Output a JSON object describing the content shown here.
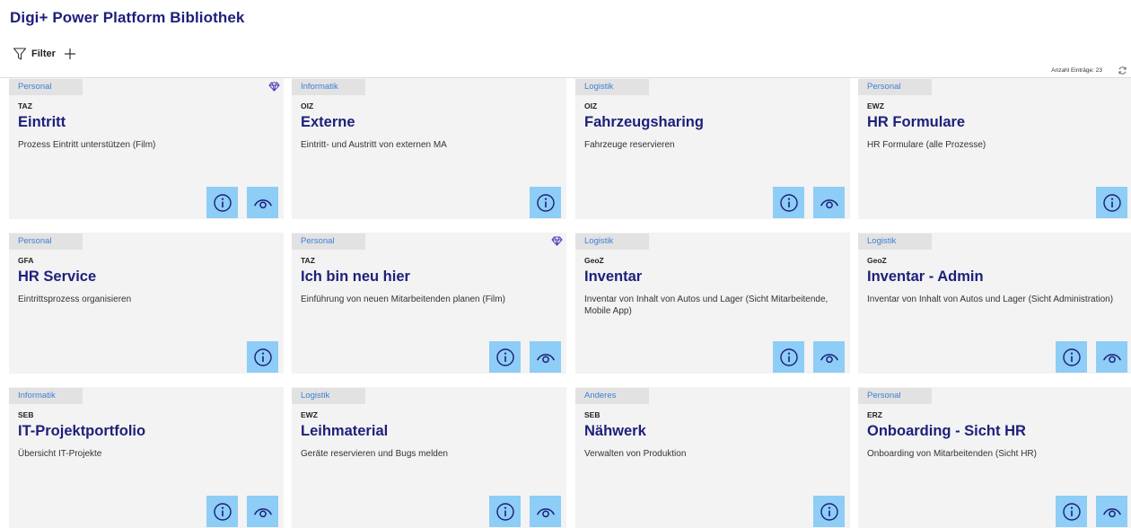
{
  "page": {
    "title": "Digi+ Power Platform Bibliothek",
    "filter_label": "Filter",
    "entry_count": "Anzahl Einträge: 23"
  },
  "colors": {
    "title": "#1d1f7a",
    "category_text": "#3d7fd4",
    "button_bg": "#8dcdf6",
    "card_bg": "#f3f3f3"
  },
  "cards": [
    {
      "category": "Personal",
      "org": "TAZ",
      "name": "Eintritt",
      "description": "Prozess Eintritt unterstützen (Film)",
      "premium": true,
      "info": true,
      "view": true
    },
    {
      "category": "Informatik",
      "org": "OIZ",
      "name": "Externe",
      "description": "Eintritt- und Austritt von externen MA",
      "premium": false,
      "info": true,
      "view": false
    },
    {
      "category": "Logistik",
      "org": "OIZ",
      "name": "Fahrzeugsharing",
      "description": "Fahrzeuge reservieren",
      "premium": false,
      "info": true,
      "view": true
    },
    {
      "category": "Personal",
      "org": "EWZ",
      "name": "HR Formulare",
      "description": "HR Formulare (alle Prozesse)",
      "premium": false,
      "info": true,
      "view": false
    },
    {
      "category": "Personal",
      "org": "GFA",
      "name": "HR Service",
      "description": "Eintrittsprozess organisieren",
      "premium": false,
      "info": true,
      "view": false
    },
    {
      "category": "Personal",
      "org": "TAZ",
      "name": "Ich bin neu hier",
      "description": "Einführung von neuen Mitarbeitenden planen (Film)",
      "premium": true,
      "info": true,
      "view": true
    },
    {
      "category": "Logistik",
      "org": "GeoZ",
      "name": "Inventar",
      "description": "Inventar von Inhalt von Autos und Lager (Sicht Mitarbeitende, Mobile App)",
      "premium": false,
      "info": true,
      "view": true
    },
    {
      "category": "Logistik",
      "org": "GeoZ",
      "name": "Inventar - Admin",
      "description": "Inventar von Inhalt von Autos und Lager (Sicht Administration)",
      "premium": false,
      "info": true,
      "view": true
    },
    {
      "category": "Informatik",
      "org": "SEB",
      "name": "IT-Projektportfolio",
      "description": "Übersicht IT-Projekte",
      "premium": false,
      "info": true,
      "view": true
    },
    {
      "category": "Logistik",
      "org": "EWZ",
      "name": "Leihmaterial",
      "description": "Geräte reservieren und Bugs melden",
      "premium": false,
      "info": true,
      "view": true
    },
    {
      "category": "Anderes",
      "org": "SEB",
      "name": "Nähwerk",
      "description": "Verwalten von Produktion",
      "premium": false,
      "info": true,
      "view": false
    },
    {
      "category": "Personal",
      "org": "ERZ",
      "name": "Onboarding - Sicht HR",
      "description": "Onboarding von Mitarbeitenden (Sicht HR)",
      "premium": false,
      "info": true,
      "view": true
    }
  ]
}
